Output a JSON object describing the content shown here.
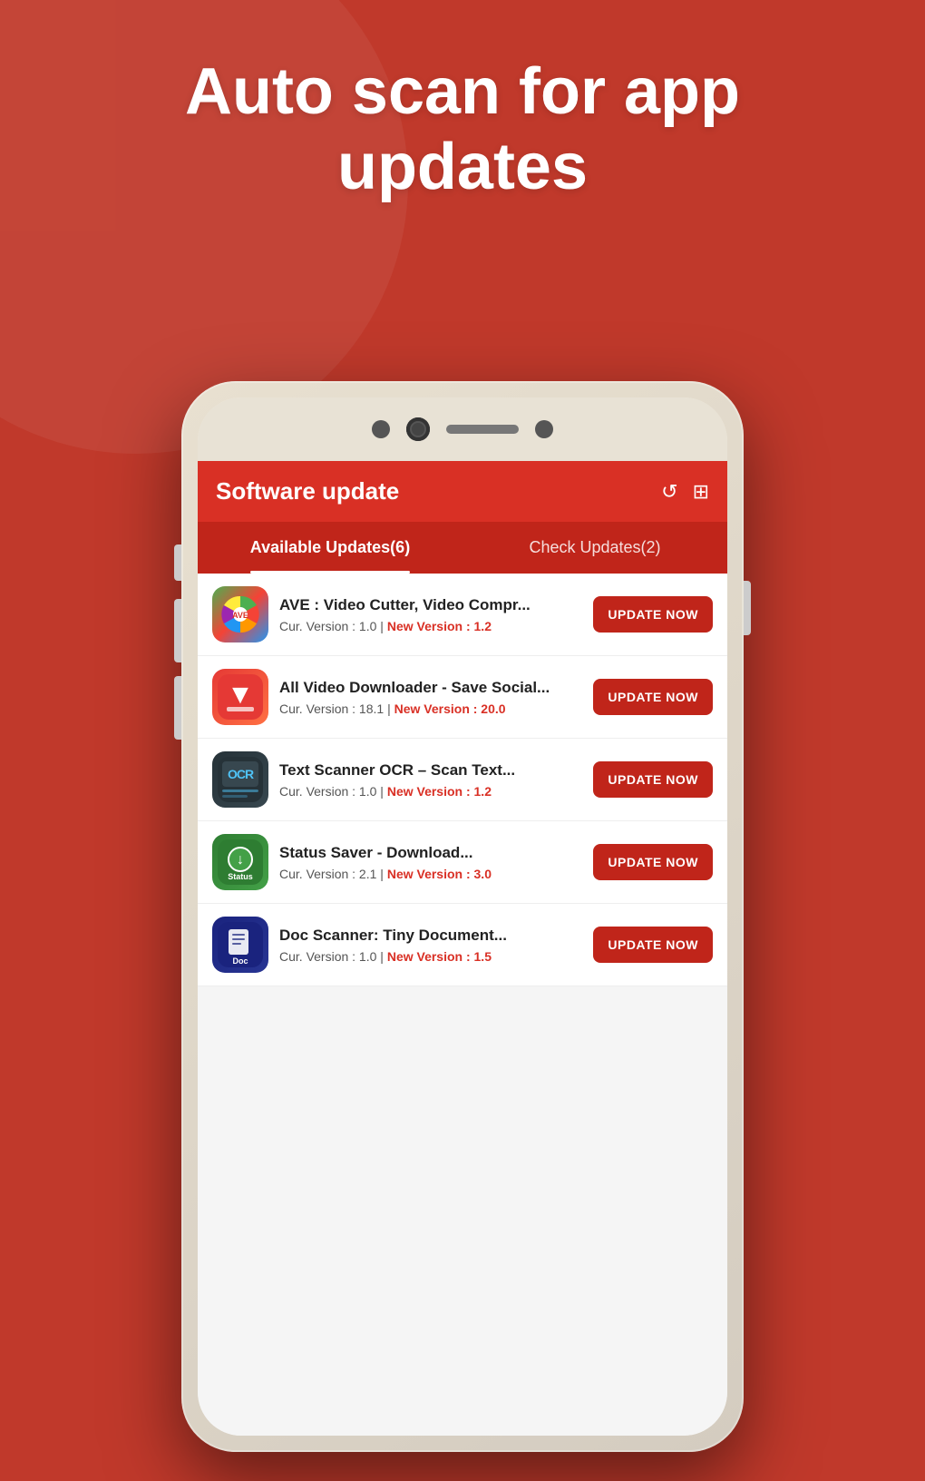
{
  "hero": {
    "title": "Auto scan for app updates"
  },
  "app_header": {
    "title": "Software update",
    "refresh_icon": "↺",
    "grid_icon": "⊞"
  },
  "tabs": [
    {
      "label": "Available Updates(6)",
      "active": true
    },
    {
      "label": "Check Updates(2)",
      "active": false
    }
  ],
  "app_list": [
    {
      "name": "AVE : Video Cutter,  Video Compr...",
      "current_version": "Cur. Version : 1.0",
      "new_version": "New Version : 1.2",
      "update_label": "UPDATE NOW",
      "icon_type": "ave"
    },
    {
      "name": "All Video Downloader - Save Social...",
      "current_version": "Cur. Version : 18.1",
      "new_version": "New Version : 20.0",
      "update_label": "UPDATE NOW",
      "icon_type": "video-dl"
    },
    {
      "name": "Text Scanner OCR – Scan Text...",
      "current_version": "Cur. Version : 1.0",
      "new_version": "New Version : 1.2",
      "update_label": "UPDATE NOW",
      "icon_type": "ocr"
    },
    {
      "name": "Status Saver - Download...",
      "current_version": "Cur. Version : 2.1",
      "new_version": "New Version : 3.0",
      "update_label": "UPDATE NOW",
      "icon_type": "status"
    },
    {
      "name": "Doc Scanner: Tiny Document...",
      "current_version": "Cur. Version : 1.0",
      "new_version": "New Version : 1.5",
      "update_label": "UPDATE NOW",
      "icon_type": "doc"
    }
  ],
  "colors": {
    "accent": "#c0251a",
    "background": "#c0392b",
    "white": "#ffffff",
    "new_version": "#d93025"
  }
}
